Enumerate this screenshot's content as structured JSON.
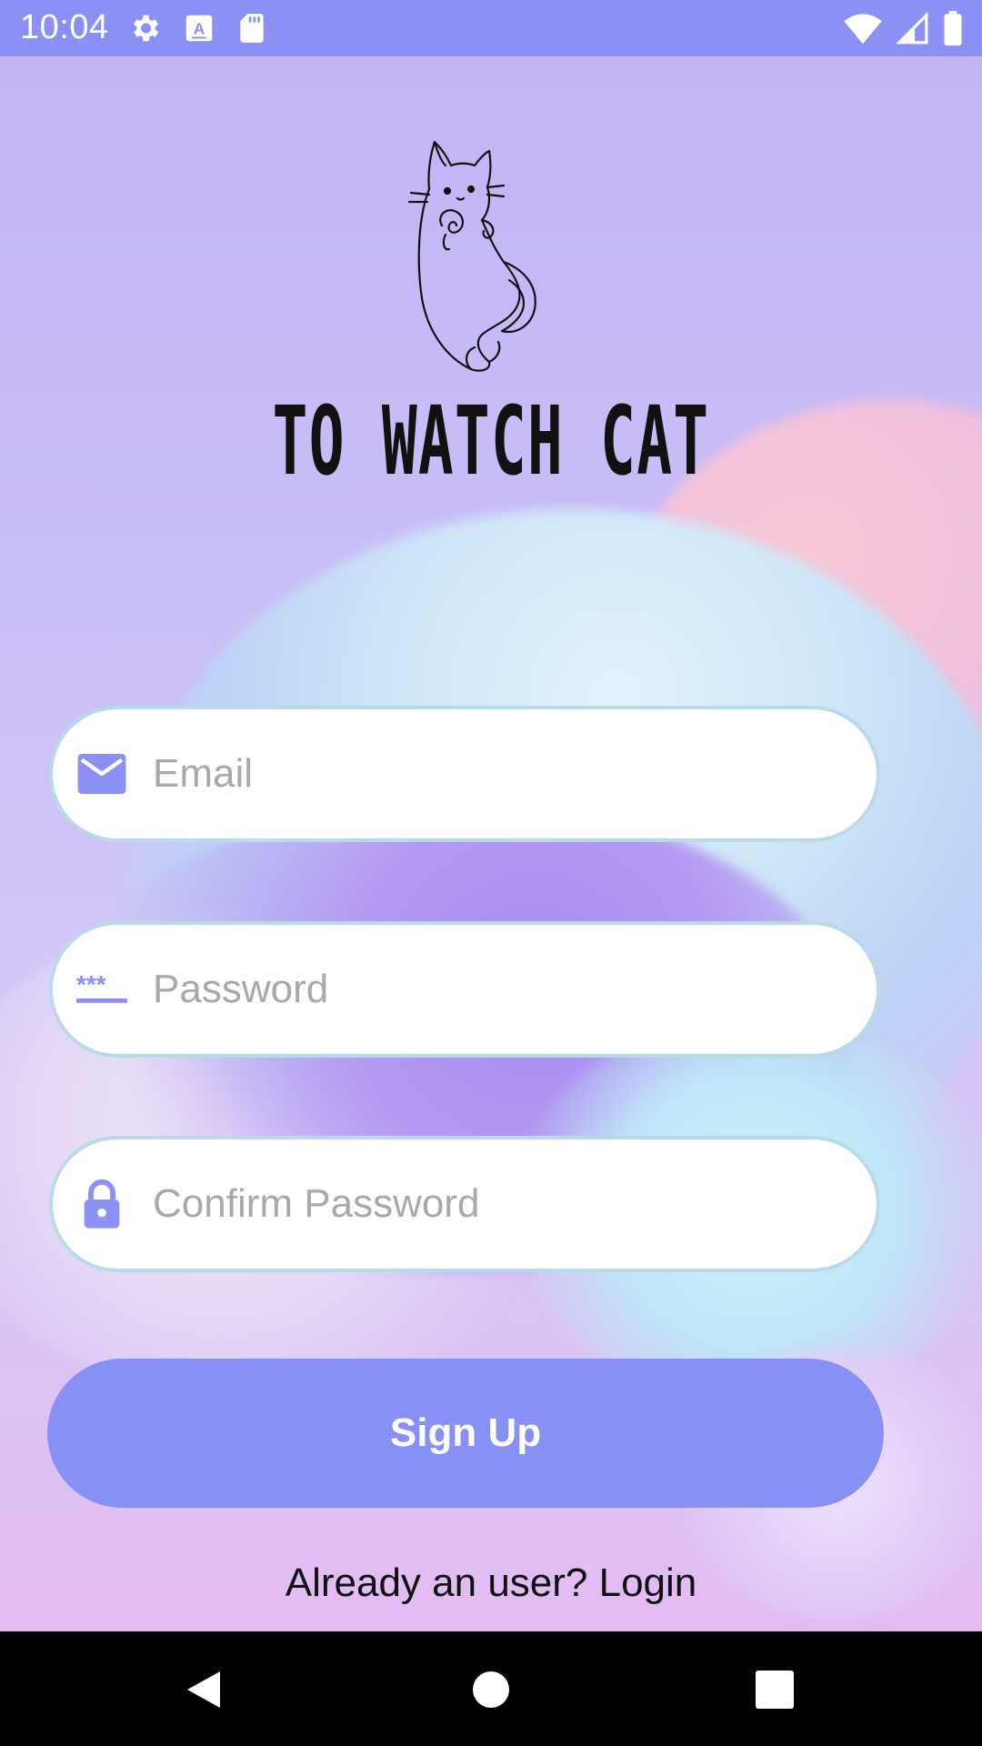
{
  "status_bar": {
    "time": "10:04",
    "left_icons": [
      "settings-icon",
      "keyboard-a-icon",
      "sd-card-icon"
    ],
    "right_icons": [
      "wifi-icon",
      "cell-signal-icon",
      "battery-icon"
    ],
    "color": "#8a90f4"
  },
  "app": {
    "title": "TO WATCH CAT",
    "logo_icon": "cat-logo-icon"
  },
  "form": {
    "email": {
      "placeholder": "Email",
      "value": "",
      "icon": "mail-icon"
    },
    "password": {
      "placeholder": "Password",
      "value": "",
      "icon": "password-icon"
    },
    "confirm_password": {
      "placeholder": "Confirm Password",
      "value": "",
      "icon": "lock-icon"
    },
    "submit_label": "Sign Up",
    "login_prompt": "Already an user? Login"
  },
  "colors": {
    "accent": "#8790f5",
    "field_border": "#b8dbe8",
    "nav_bar": "#000000"
  },
  "nav_bar": {
    "buttons": [
      "back-icon",
      "home-icon",
      "recents-icon"
    ]
  }
}
